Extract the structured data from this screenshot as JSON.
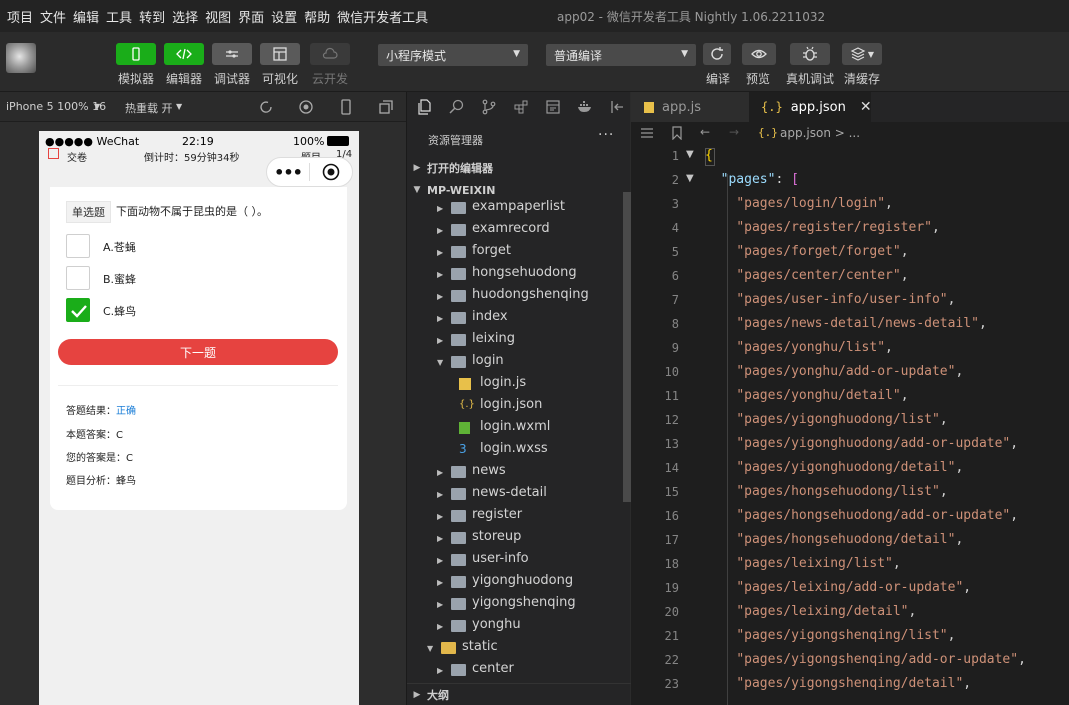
{
  "menubar": {
    "items": [
      "项目",
      "文件",
      "编辑",
      "工具",
      "转到",
      "选择",
      "视图",
      "界面",
      "设置",
      "帮助",
      "微信开发者工具"
    ],
    "window_title": "app02 - 微信开发者工具 Nightly 1.06.2211032"
  },
  "toolbar": {
    "simulator": "模拟器",
    "editor": "编辑器",
    "debugger": "调试器",
    "visual": "可视化",
    "cloud": "云开发",
    "mode_select": "小程序模式",
    "compile_select": "普通编译",
    "compile": "编译",
    "preview": "预览",
    "real_debug": "真机调试",
    "clear_cache": "清缓存"
  },
  "simulator": {
    "device": "iPhone 5 100% 16",
    "hot_reload": "热重载 开",
    "status": {
      "carrier": "●●●●● WeChat",
      "time": "22:19",
      "battery": "100%"
    },
    "timer_row": {
      "submit": "交卷",
      "countdown": "倒计时：59分钟34秒",
      "progress_label": "题目",
      "progress": "1/4"
    },
    "question_type": "单选题",
    "question_text": "下面动物不属于昆虫的是（ ）。",
    "options": [
      {
        "label": "A.苍蝇",
        "checked": false
      },
      {
        "label": "B.蜜蜂",
        "checked": false
      },
      {
        "label": "C.蜂鸟",
        "checked": true
      }
    ],
    "next_button": "下一题",
    "result_label": "答题结果：",
    "result_value": "正确",
    "answer": "本题答案：C",
    "your_answer": "您的答案是：C",
    "analysis": "题目分析：蜂鸟"
  },
  "explorer": {
    "title": "资源管理器",
    "more": "···",
    "open_editors": "打开的编辑器",
    "project": "MP-WEIXIN",
    "outline": "大纲",
    "tree": [
      {
        "label": "exampaperlist",
        "type": "folder"
      },
      {
        "label": "examrecord",
        "type": "folder"
      },
      {
        "label": "forget",
        "type": "folder"
      },
      {
        "label": "hongsehuodong",
        "type": "folder"
      },
      {
        "label": "huodongshenqing",
        "type": "folder"
      },
      {
        "label": "index",
        "type": "folder"
      },
      {
        "label": "leixing",
        "type": "folder"
      },
      {
        "label": "login",
        "type": "folder-open"
      },
      {
        "label": "login.js",
        "type": "js"
      },
      {
        "label": "login.json",
        "type": "json"
      },
      {
        "label": "login.wxml",
        "type": "wxml"
      },
      {
        "label": "login.wxss",
        "type": "wxss"
      },
      {
        "label": "news",
        "type": "folder"
      },
      {
        "label": "news-detail",
        "type": "folder"
      },
      {
        "label": "register",
        "type": "folder"
      },
      {
        "label": "storeup",
        "type": "folder"
      },
      {
        "label": "user-info",
        "type": "folder"
      },
      {
        "label": "yigonghuodong",
        "type": "folder"
      },
      {
        "label": "yigongshenqing",
        "type": "folder"
      },
      {
        "label": "yonghu",
        "type": "folder"
      },
      {
        "label": "static",
        "type": "folder-open-yellow"
      },
      {
        "label": "center",
        "type": "folder"
      }
    ]
  },
  "editor": {
    "tab_inactive": "app.js",
    "tab_active": "app.json",
    "breadcrumb": "app.json > ...",
    "pages_key": "\"pages\"",
    "pages": [
      "pages/login/login",
      "pages/register/register",
      "pages/forget/forget",
      "pages/center/center",
      "pages/user-info/user-info",
      "pages/news-detail/news-detail",
      "pages/yonghu/list",
      "pages/yonghu/add-or-update",
      "pages/yonghu/detail",
      "pages/yigonghuodong/list",
      "pages/yigonghuodong/add-or-update",
      "pages/yigonghuodong/detail",
      "pages/hongsehuodong/list",
      "pages/hongsehuodong/add-or-update",
      "pages/hongsehuodong/detail",
      "pages/leixing/list",
      "pages/leixing/add-or-update",
      "pages/leixing/detail",
      "pages/yigongshenqing/list",
      "pages/yigongshenqing/add-or-update",
      "pages/yigongshenqing/detail"
    ]
  },
  "colors": {
    "accent_green": "#1aad19",
    "danger_red": "#e64340",
    "string": "#ce9178",
    "link_blue": "#1a7dd7"
  }
}
